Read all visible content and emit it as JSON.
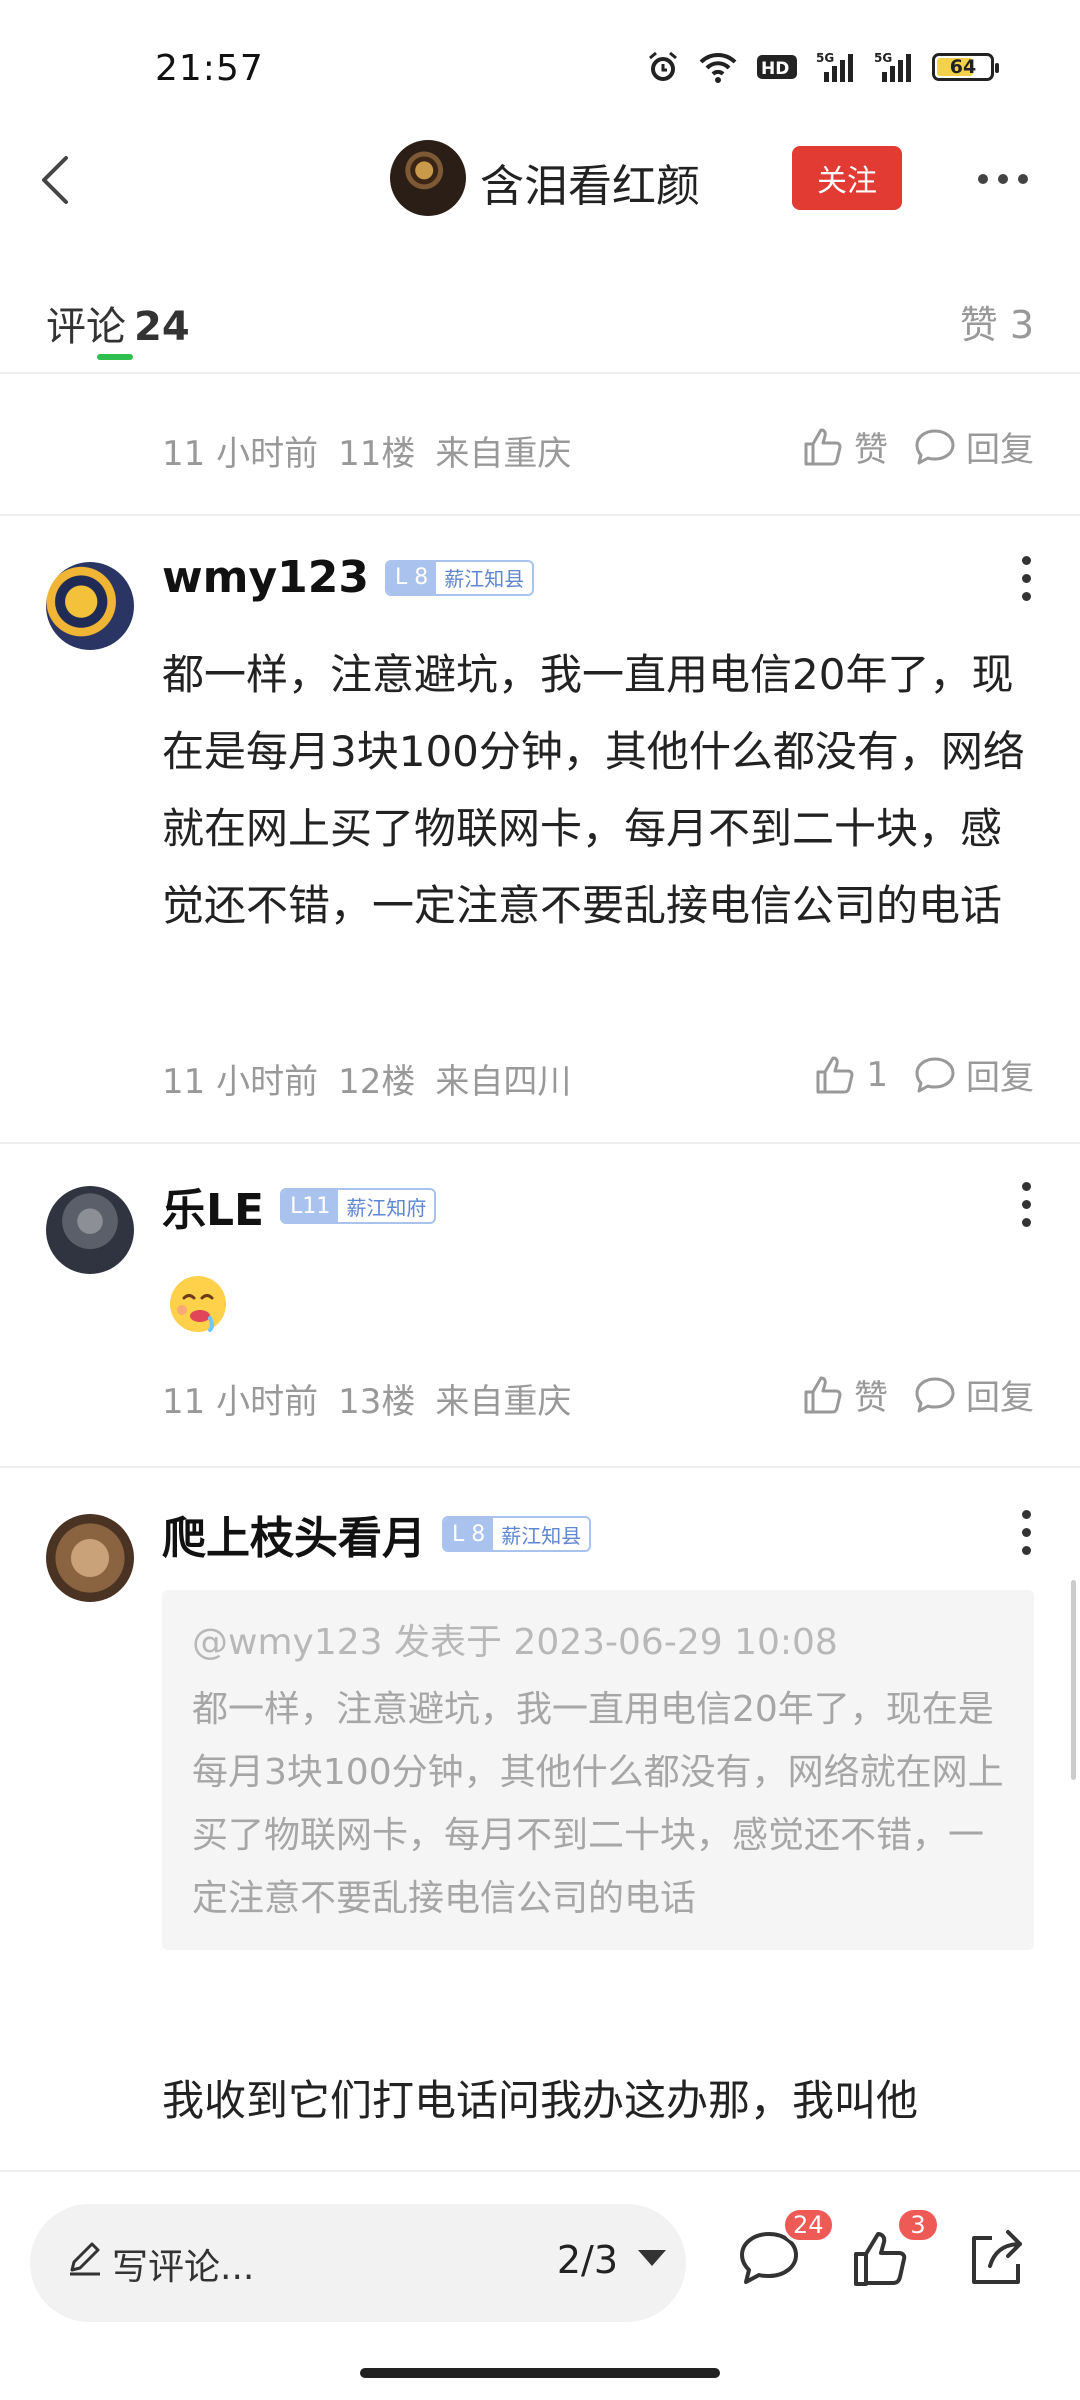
{
  "status_bar": {
    "time": "21:57",
    "battery": "64",
    "network_1": "5G",
    "network_2": "5G",
    "hd": "HD"
  },
  "header": {
    "author_name": "含泪看红颜",
    "follow_label": "关注"
  },
  "tabs": {
    "comments_label": "评论",
    "comments_count": "24",
    "likes_label": "赞 3"
  },
  "comments": [
    {
      "time": "11 小时前",
      "floor": "11楼",
      "location": "来自重庆",
      "like_label": "赞",
      "reply_label": "回复"
    },
    {
      "username": "wmy123",
      "level": "L 8",
      "rank": "薪江知县",
      "text": "都一样，注意避坑，我一直用电信20年了，现在是每月3块100分钟，其他什么都没有，网络就在网上买了物联网卡，每月不到二十块，感觉还不错，一定注意不要乱接电信公司的电话",
      "time": "11 小时前",
      "floor": "12楼",
      "location": "来自四川",
      "like_count": "1",
      "reply_label": "回复"
    },
    {
      "username": "乐LE",
      "level": "L11",
      "rank": "薪江知府",
      "text": "",
      "time": "11 小时前",
      "floor": "13楼",
      "location": "来自重庆",
      "like_label": "赞",
      "reply_label": "回复"
    },
    {
      "username": "爬上枝头看月",
      "level": "L 8",
      "rank": "薪江知县",
      "quote_head": "@wmy123 发表于 2023-06-29 10:08",
      "quote_body": "都一样，注意避坑，我一直用电信20年了，现在是每月3块100分钟，其他什么都没有，网络就在网上买了物联网卡，每月不到二十块，感觉还不错，一定注意不要乱接电信公司的电话",
      "text": "我收到它们打电话问我办这办那，我叫他"
    }
  ],
  "bottom_bar": {
    "write_placeholder": "写评论...",
    "page_indicator": "2/3",
    "comment_count": "24",
    "like_count": "3"
  },
  "colors": {
    "follow_red": "#e23b34",
    "tab_green": "#2fbf4f",
    "badge_blue": "#a9c3ee",
    "count_red": "#ee5a55"
  }
}
